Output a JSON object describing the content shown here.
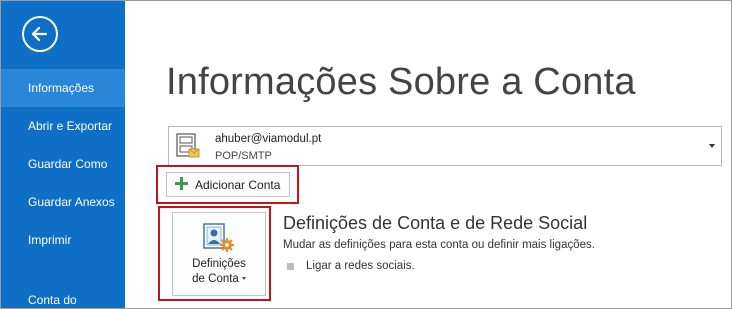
{
  "sidebar": {
    "items": [
      {
        "label": "Informações"
      },
      {
        "label": "Abrir e Exportar"
      },
      {
        "label": "Guardar Como"
      },
      {
        "label": "Guardar Anexos"
      },
      {
        "label": "Imprimir"
      },
      {
        "label": "Conta do"
      }
    ]
  },
  "main": {
    "title": "Informações Sobre a Conta",
    "account": {
      "email": "ahuber@viamodul.pt",
      "type": "POP/SMTP"
    },
    "add_account_label": "Adicionar Conta",
    "settings_tile": {
      "line1": "Definições",
      "line2": "de Conta"
    },
    "section": {
      "title": "Definições de Conta e de Rede Social",
      "description": "Mudar as definições para esta conta ou definir mais ligações.",
      "bullet": "Ligar a redes sociais."
    }
  },
  "colors": {
    "sidebar_bg": "#0f6fc6",
    "sidebar_active": "#2a86d8",
    "highlight_border": "#c0161b",
    "add_icon": "#3e9c4b"
  },
  "icons": [
    "back-arrow-icon",
    "account-card-icon",
    "plus-icon",
    "account-settings-icon",
    "chevron-down-icon"
  ]
}
